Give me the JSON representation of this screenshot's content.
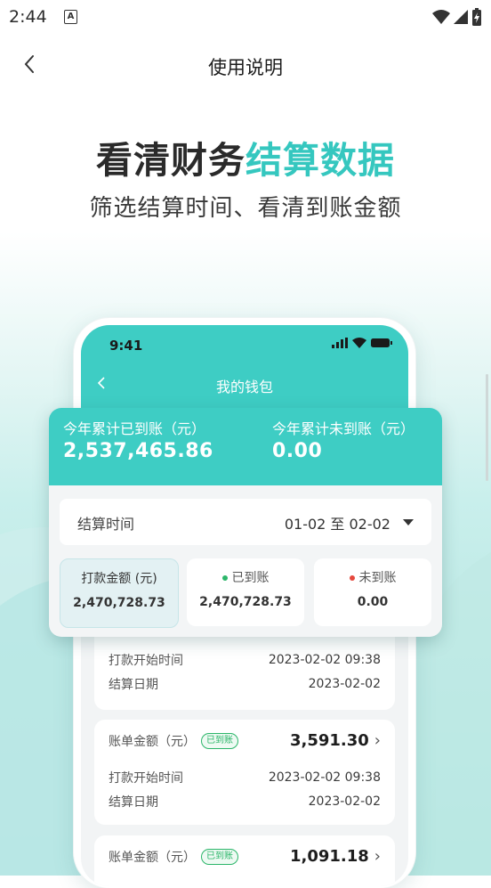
{
  "status_bar": {
    "time": "2:44",
    "notification_icon": "A"
  },
  "nav": {
    "title": "使用说明",
    "back_icon": "chevron-left-icon"
  },
  "headline": {
    "part1": "看清财务",
    "part2": "结算数据",
    "subtitle": "筛选结算时间、看清到账金额"
  },
  "colors": {
    "teal": "#3ecdc4",
    "headline_teal": "#35c7bf",
    "received_green": "#2cb66a",
    "pending_red": "#e5483d"
  },
  "phone": {
    "time": "9:41",
    "title": "我的钱包",
    "records": [
      {
        "start_label": "打款开始时间",
        "start_value": "2023-02-02 09:38",
        "date_label": "结算日期",
        "date_value": "2023-02-02"
      },
      {
        "amount_label": "账单金额（元）",
        "badge": "已到账",
        "amount": "3,591.30",
        "start_label": "打款开始时间",
        "start_value": "2023-02-02 09:38",
        "date_label": "结算日期",
        "date_value": "2023-02-02"
      },
      {
        "amount_label": "账单金额（元）",
        "badge": "已到账",
        "amount": "1,091.18"
      }
    ]
  },
  "summary": {
    "received_label": "今年累计已到账（元）",
    "received_value": "2,537,465.86",
    "pending_label": "今年累计未到账（元）",
    "pending_value": "0.00",
    "filter_label": "结算时间",
    "filter_range": "01-02 至 02-02",
    "tiles": [
      {
        "label": "打款金额 (元)",
        "value": "2,470,728.73"
      },
      {
        "label": "已到账",
        "value": "2,470,728.73"
      },
      {
        "label": "未到账",
        "value": "0.00"
      }
    ]
  }
}
